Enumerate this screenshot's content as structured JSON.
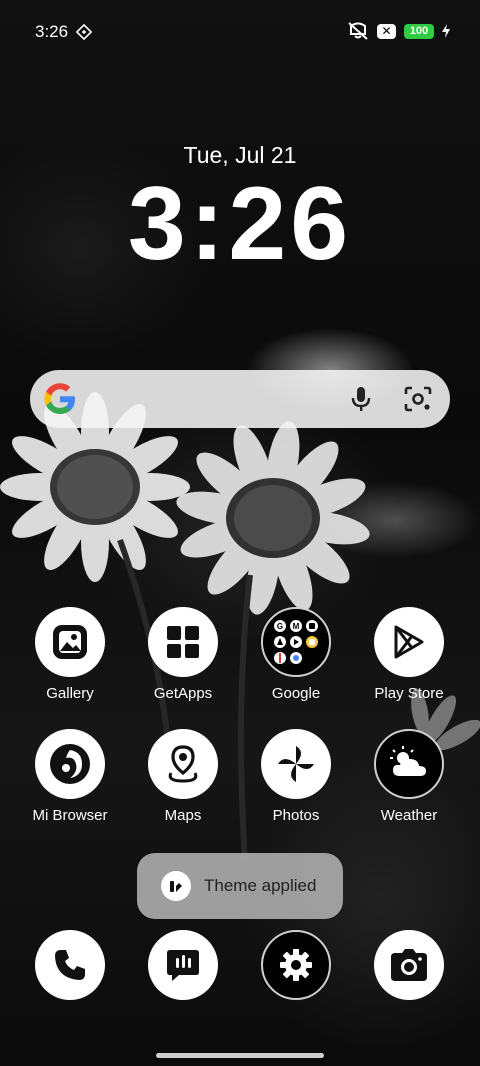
{
  "status_bar": {
    "time": "3:26",
    "battery_level": "100"
  },
  "clock_widget": {
    "date": "Tue, Jul 21",
    "time": "3:26"
  },
  "search_bar": {
    "logo_icon": "google-g-icon",
    "mic_icon": "mic-icon",
    "lens_icon": "lens-icon"
  },
  "apps": [
    {
      "label": "Gallery",
      "icon": "gallery-icon"
    },
    {
      "label": "GetApps",
      "icon": "getapps-icon"
    },
    {
      "label": "Google",
      "icon": "google-folder-icon"
    },
    {
      "label": "Play Store",
      "icon": "play-store-icon"
    },
    {
      "label": "Mi Browser",
      "icon": "mi-browser-icon"
    },
    {
      "label": "Maps",
      "icon": "maps-icon"
    },
    {
      "label": "Photos",
      "icon": "photos-icon"
    },
    {
      "label": "Weather",
      "icon": "weather-icon"
    }
  ],
  "toast": {
    "text": "Theme applied"
  },
  "dock": [
    {
      "icon": "phone-icon"
    },
    {
      "icon": "messages-icon"
    },
    {
      "icon": "settings-icon"
    },
    {
      "icon": "camera-icon"
    }
  ],
  "colors": {
    "battery": "#2ecc40",
    "search_bar": "#f5f5f5",
    "toast": "#aaaaaa"
  }
}
